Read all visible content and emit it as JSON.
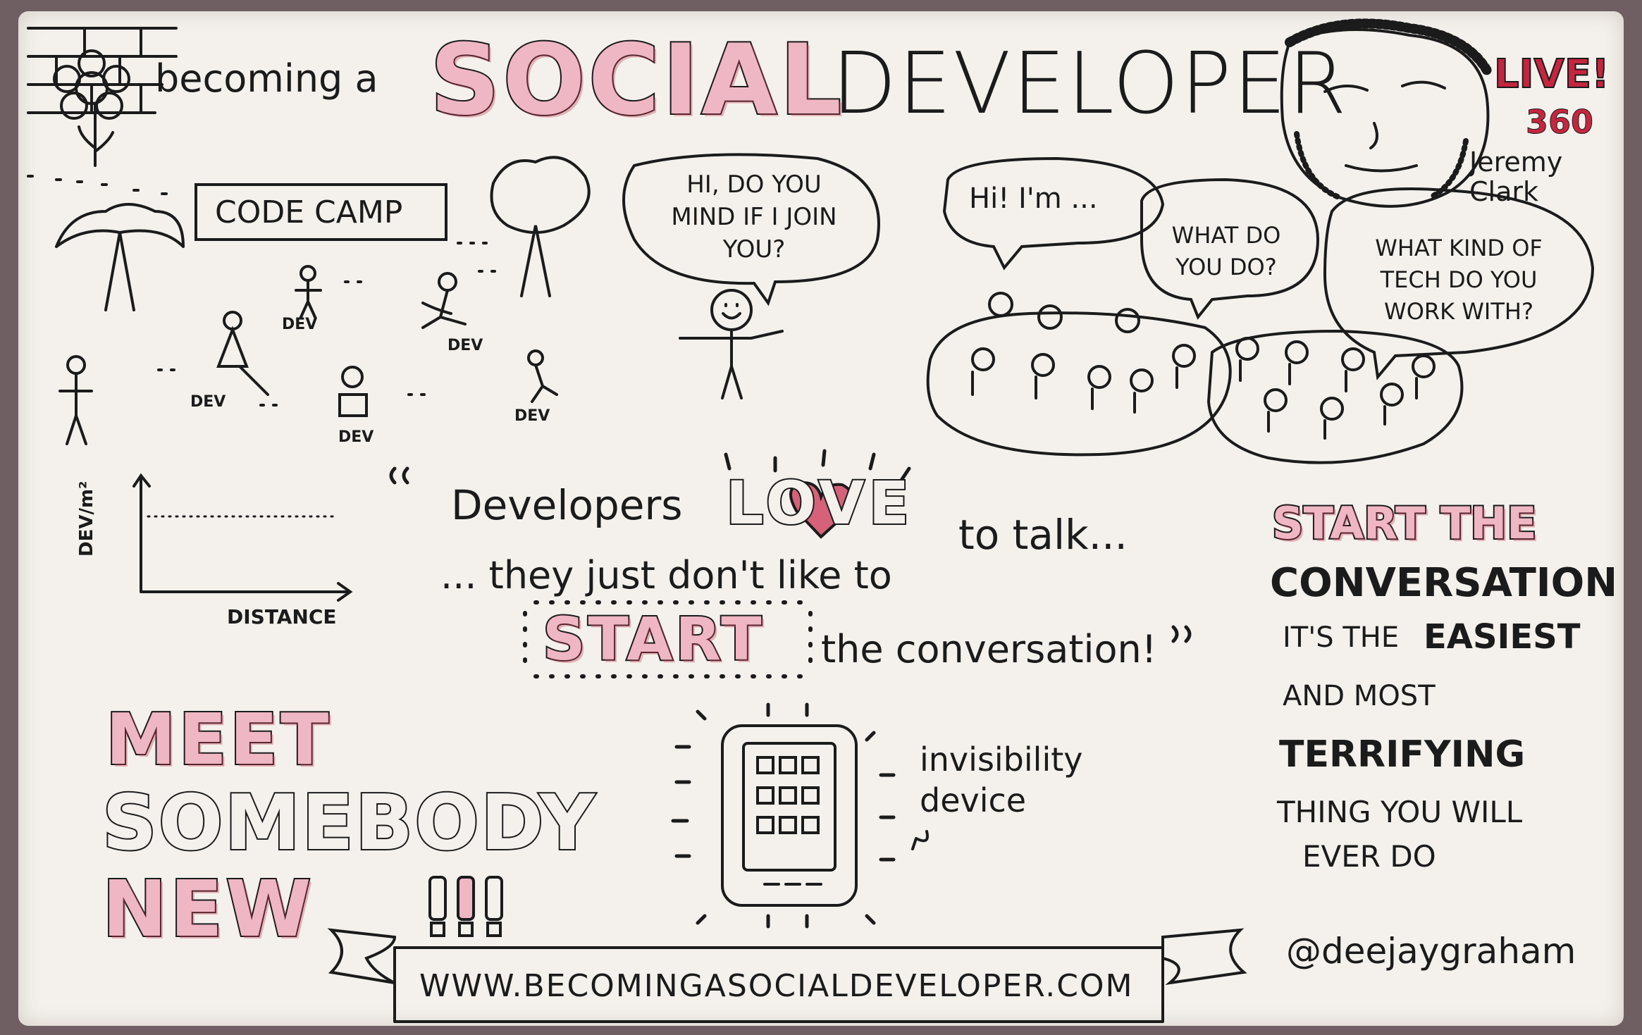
{
  "header": {
    "prefix": "becoming a",
    "social": "SOCIAL",
    "developer": "DEVELOPER",
    "live": "LIVE!",
    "live_number": "360",
    "author": "Jeremy Clark"
  },
  "scene": {
    "sign": "CODE CAMP",
    "dev_labels": [
      "DEV",
      "DEV",
      "DEV",
      "DEV",
      "DEV"
    ],
    "speech_join": "HI, DO YOU MIND IF I JOIN YOU?",
    "speech_hi": "Hi! I'm ...",
    "speech_what": "WHAT DO YOU DO?",
    "speech_tech": "WHAT KIND OF TECH DO YOU WORK WITH?"
  },
  "graph": {
    "ylabel": "DEV/m²",
    "xlabel": "DISTANCE"
  },
  "quote": {
    "line1_start": "Developers",
    "love": "LOVE",
    "line1_end": "to talk...",
    "line2": "... they just don't like to",
    "start": "START",
    "line3_end": "the conversation!"
  },
  "right_panel": {
    "start_the": "START THE",
    "conversation": "CONVERSATION",
    "its_the": "IT'S THE",
    "easiest": "EASIEST",
    "and_most": "AND MOST",
    "terrifying": "TERRIFYING",
    "thing_you_will": "THING YOU WILL",
    "ever_do": "EVER DO"
  },
  "meet": {
    "line1": "MEET",
    "line2": "SOMEBODY",
    "line3": "NEW",
    "bangs": "!!!"
  },
  "device": {
    "caption": "invisibility device"
  },
  "footer": {
    "handle": "@deejaygraham",
    "url": "WWW.BECOMINGASOCIALDEVELOPER.COM"
  },
  "colors": {
    "paper": "#f4f1ec",
    "ink": "#1b1b1b",
    "accent": "#c4263f",
    "pink": "#efb7c3"
  }
}
